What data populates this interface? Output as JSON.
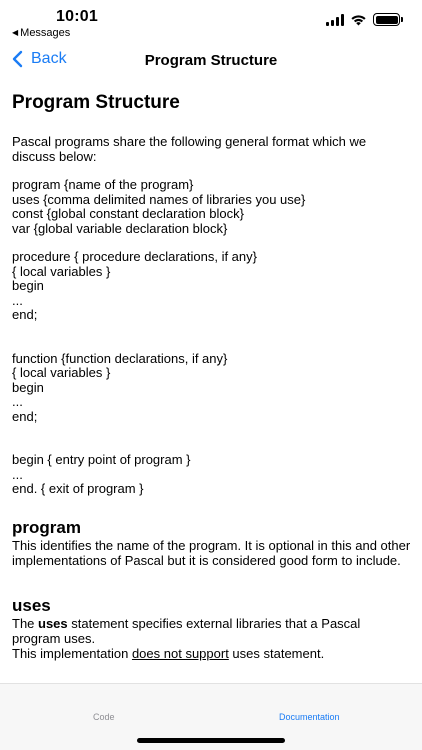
{
  "status": {
    "time": "10:01",
    "back_app": "Messages"
  },
  "nav": {
    "back_label": "Back",
    "title": "Program Structure"
  },
  "doc": {
    "heading": "Program Structure",
    "intro": "Pascal programs share the following general format which we discuss below:",
    "program_block": [
      "program {name of the program}",
      "uses {comma delimited names of libraries you use}",
      "const {global constant declaration block}",
      "var {global variable declaration block}"
    ],
    "procedure_block": [
      "procedure { procedure declarations, if any}",
      "{ local variables }",
      "begin",
      "...",
      "end;"
    ],
    "function_block": [
      "function {function declarations, if any}",
      "{ local variables }",
      "begin",
      "...",
      "end;"
    ],
    "main_block": [
      "begin { entry point of program }",
      "...",
      "end. { exit of program }"
    ],
    "program_section": {
      "title": "program",
      "text": "This identifies the name of the program. It is optional in this and other implementations of Pascal but it is considered good form to include."
    },
    "uses_section": {
      "title": "uses",
      "text_before": "The ",
      "keyword": "uses",
      "text_after": " statement specifies external libraries that a Pascal program uses.",
      "line2_before": "This implementation ",
      "line2_link": "does not support",
      "line2_after": " uses statement."
    }
  },
  "tabs": {
    "code": "Code",
    "documentation": "Documentation"
  },
  "colors": {
    "accent": "#1a7cf5",
    "inactive_tab": "#8e8e93"
  }
}
